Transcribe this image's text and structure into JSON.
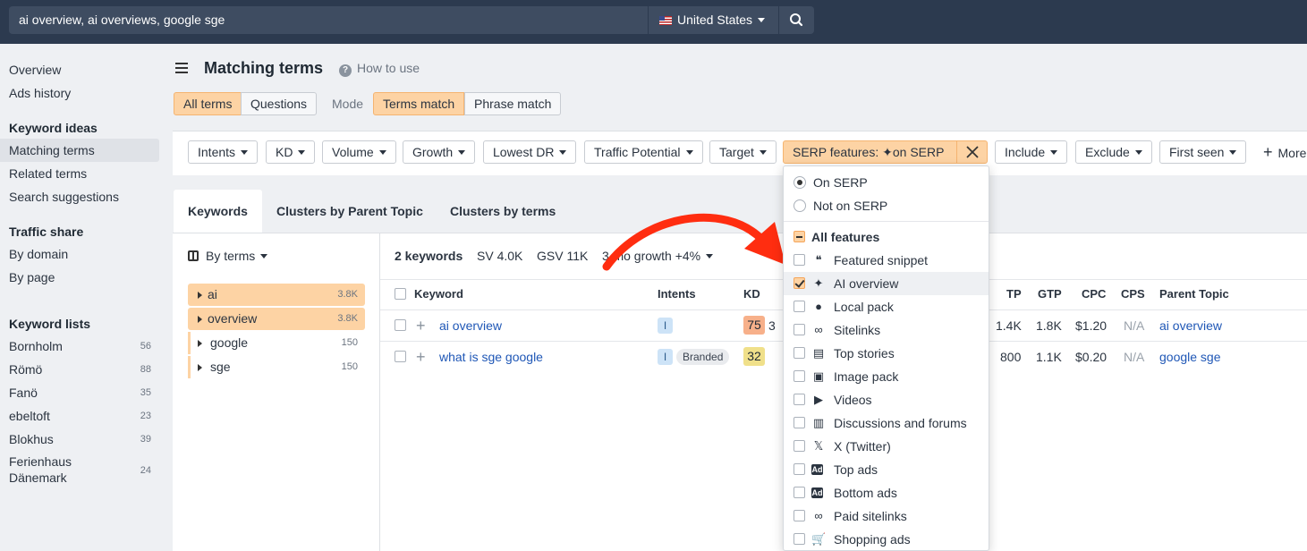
{
  "topbar": {
    "search_value": "ai overview, ai overviews, google sge",
    "country": "United States",
    "search_icon": "search-icon"
  },
  "sidebar": {
    "top_items": [
      "Overview",
      "Ads history"
    ],
    "keyword_ideas_title": "Keyword ideas",
    "keyword_ideas": [
      "Matching terms",
      "Related terms",
      "Search suggestions"
    ],
    "traffic_share_title": "Traffic share",
    "traffic_share": [
      "By domain",
      "By page"
    ],
    "keyword_lists_title": "Keyword lists",
    "keyword_lists": [
      {
        "name": "Bornholm",
        "count": "56"
      },
      {
        "name": "Römö",
        "count": "88"
      },
      {
        "name": "Fanö",
        "count": "35"
      },
      {
        "name": "ebeltoft",
        "count": "23"
      },
      {
        "name": "Blokhus",
        "count": "39"
      },
      {
        "name": "Ferienhaus",
        "name2": "Dänemark",
        "count": "24"
      }
    ]
  },
  "header": {
    "title": "Matching terms",
    "help": "How to use",
    "terms_toggle": [
      "All terms",
      "Questions"
    ],
    "mode_label": "Mode",
    "mode_toggle": [
      "Terms match",
      "Phrase match"
    ]
  },
  "filters": {
    "buttons": [
      "Intents",
      "KD",
      "Volume",
      "Growth",
      "Lowest DR",
      "Traffic Potential",
      "Target"
    ],
    "serp_label_a": "SERP features:",
    "serp_label_b": "on SERP",
    "buttons2": [
      "Include",
      "Exclude",
      "First seen"
    ],
    "more": "More"
  },
  "tabs": [
    "Keywords",
    "Clusters by Parent Topic",
    "Clusters by terms"
  ],
  "terms_panel": {
    "by_terms": "By terms",
    "terms": [
      {
        "label": "ai",
        "count": "3.8K",
        "selected": true
      },
      {
        "label": "overview",
        "count": "3.8K",
        "selected": true
      },
      {
        "label": "google",
        "count": "150",
        "selected": false
      },
      {
        "label": "sge",
        "count": "150",
        "selected": false
      }
    ]
  },
  "summary": {
    "keywords": "2 keywords",
    "sv": "SV 4.0K",
    "gsv": "GSV 11K",
    "growth": "3-mo growth +4%"
  },
  "table": {
    "headers": {
      "keyword": "Keyword",
      "intents": "Intents",
      "kd": "KD",
      "tp": "TP",
      "gtp": "GTP",
      "cpc": "CPC",
      "cps": "CPS",
      "parent": "Parent Topic"
    },
    "rows": [
      {
        "keyword": "ai overview",
        "intent": "I",
        "branded": "",
        "kd": "75",
        "kd_color": "#f7b08a",
        "vol_partial": "3",
        "tp": "1.4K",
        "gtp": "1.8K",
        "cpc": "$1.20",
        "cps": "N/A",
        "parent": "ai overview"
      },
      {
        "keyword": "what is sge google",
        "intent": "I",
        "branded": "Branded",
        "kd": "32",
        "kd_color": "#f0e08a",
        "vol_partial": "",
        "tp": "800",
        "gtp": "1.1K",
        "cpc": "$0.20",
        "cps": "N/A",
        "parent": "google sge"
      }
    ]
  },
  "dropdown": {
    "radio": [
      {
        "label": "On SERP",
        "selected": true
      },
      {
        "label": "Not on SERP",
        "selected": false
      }
    ],
    "all_features": "All features",
    "features": [
      {
        "label": "Featured snippet",
        "icon": "quote-icon",
        "glyph": "❝",
        "checked": false
      },
      {
        "label": "AI overview",
        "icon": "sparkle-icon",
        "glyph": "✦",
        "checked": true
      },
      {
        "label": "Local pack",
        "icon": "map-pin-icon",
        "glyph": "●",
        "checked": false
      },
      {
        "label": "Sitelinks",
        "icon": "link-icon",
        "glyph": "∞",
        "checked": false
      },
      {
        "label": "Top stories",
        "icon": "news-icon",
        "glyph": "▤",
        "checked": false
      },
      {
        "label": "Image pack",
        "icon": "image-icon",
        "glyph": "▣",
        "checked": false
      },
      {
        "label": "Videos",
        "icon": "video-icon",
        "glyph": "▶",
        "checked": false
      },
      {
        "label": "Discussions and forums",
        "icon": "chat-icon",
        "glyph": "▥",
        "checked": false
      },
      {
        "label": "X (Twitter)",
        "icon": "x-icon",
        "glyph": "𝕏",
        "checked": false
      },
      {
        "label": "Top ads",
        "icon": "ad-icon",
        "glyph": "Ad",
        "checked": false
      },
      {
        "label": "Bottom ads",
        "icon": "ad-icon",
        "glyph": "Ad",
        "checked": false
      },
      {
        "label": "Paid sitelinks",
        "icon": "link-icon",
        "glyph": "∞",
        "checked": false
      },
      {
        "label": "Shopping ads",
        "icon": "cart-icon",
        "glyph": "🛒",
        "checked": false
      }
    ]
  },
  "colors": {
    "topbar": "#2c3a4f",
    "accent": "#fdd3a4",
    "link": "#1f57b6",
    "arrow": "#ff2d10"
  }
}
